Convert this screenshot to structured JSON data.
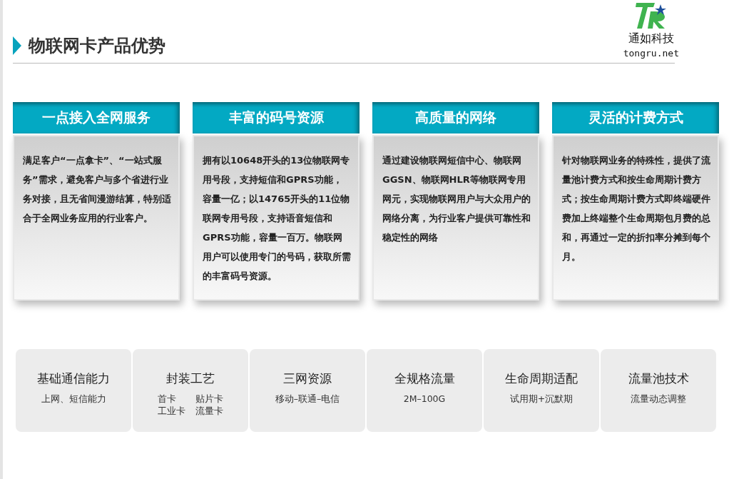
{
  "header": {
    "title": "物联网卡产品优势"
  },
  "logo": {
    "name": "通如科技",
    "url": "tongru.net"
  },
  "cards": [
    {
      "title": "一点接入全网服务",
      "body": "满足客户“一点拿卡”、“一站式服务”需求，避免客户与多个省进行业务对接，且无省间漫游结算，特别适合于全网业务应用的行业客户。"
    },
    {
      "title": "丰富的码号资源",
      "body": "拥有以10648开头的13位物联网专用号段，支持短信和GPRS功能，容量一亿；以14765开头的11位物联网专用号段，支持语音短信和GPRS功能，容量一百万。物联网用户可以使用专门的号码，获取所需的丰富码号资源。"
    },
    {
      "title": "高质量的网络",
      "body": "通过建设物联网短信中心、物联网GGSN、物联网HLR等物联网专用网元，实现物联网用户与大众用户的网络分离，为行业客户提供可靠性和稳定性的网络"
    },
    {
      "title": "灵活的计费方式",
      "body": "针对物联网业务的特殊性，提供了流量池计费方式和按生命周期计费方式；按生命周期计费方式即终端硬件费加上终端整个生命周期包月费的总和，再通过一定的折扣率分摊到每个月。"
    }
  ],
  "features": [
    {
      "title": "基础通信能力",
      "items": [
        "上网、短信能力"
      ]
    },
    {
      "title": "封装工艺",
      "items": [
        "首卡",
        "贴片卡",
        "工业卡",
        "流量卡"
      ]
    },
    {
      "title": "三网资源",
      "items": [
        "移动–联通–电信"
      ]
    },
    {
      "title": "全规格流量",
      "items": [
        "2M–100G"
      ]
    },
    {
      "title": "生命周期适配",
      "items": [
        "试用期+沉默期"
      ]
    },
    {
      "title": "流量池技术",
      "items": [
        "流量动态调整"
      ]
    }
  ]
}
